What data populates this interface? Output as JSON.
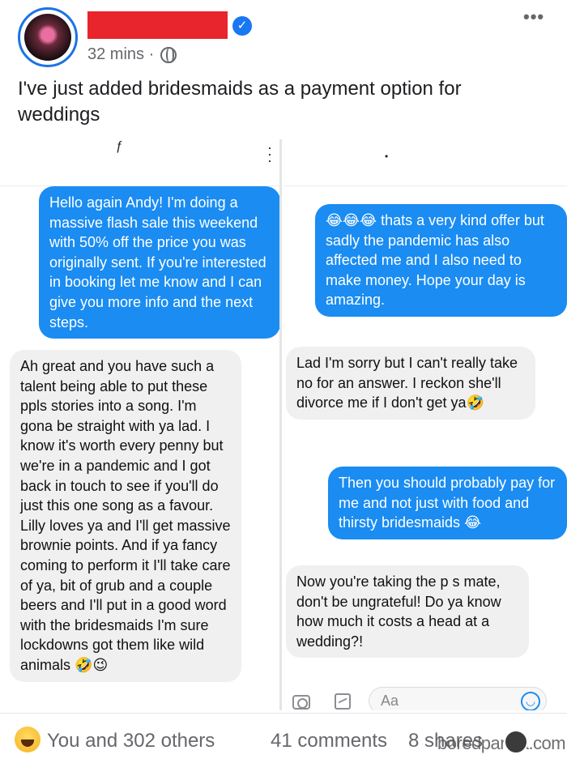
{
  "post": {
    "time": "32 mins ·",
    "caption": "I've just added bridesmaids as a payment option for weddings"
  },
  "left_screenshot": {
    "top_mark": "ƒ",
    "messages": [
      {
        "side": "sent",
        "text": "Hello again Andy! I'm doing a massive flash sale this weekend with 50% off the price you was originally sent. If you're interested in booking let me know and I can give you more info and the next steps."
      },
      {
        "side": "received",
        "text": "Ah great and you have such a talent being able to put these ppls stories into a song. I'm gona be straight with ya lad. I know it's worth every penny but we're in a pandemic and I got back in touch to see if you'll do just this one song as a favour. Lilly loves ya and I'll get massive brownie points. And if ya fancy coming to perform it I'll take care of ya, bit of grub and a couple beers and I'll put in a good word with the bridesmaids I'm sure lockdowns got them like wild animals 🤣😉"
      }
    ]
  },
  "right_screenshot": {
    "messages": [
      {
        "side": "sent",
        "text": "😂😂😂 thats a very kind offer but sadly the pandemic has also affected me and I also need to make money. Hope your day is amazing."
      },
      {
        "side": "received",
        "text": "Lad I'm sorry but I can't really take no for an answer. I reckon she'll divorce me if I don't get ya🤣"
      },
      {
        "side": "sent",
        "text": "Then you should probably pay for me and not just with food and thirsty bridesmaids 😂"
      },
      {
        "side": "received",
        "text": "Now you're taking the p  s mate, don't be ungrateful! Do ya know how much it costs a head at a wedding?!"
      }
    ],
    "composer_placeholder": "Aa"
  },
  "footer": {
    "reactions": "You and 302 others",
    "comments": "41 comments",
    "shares": "8 shares",
    "watermark": "boredpanda.com"
  }
}
